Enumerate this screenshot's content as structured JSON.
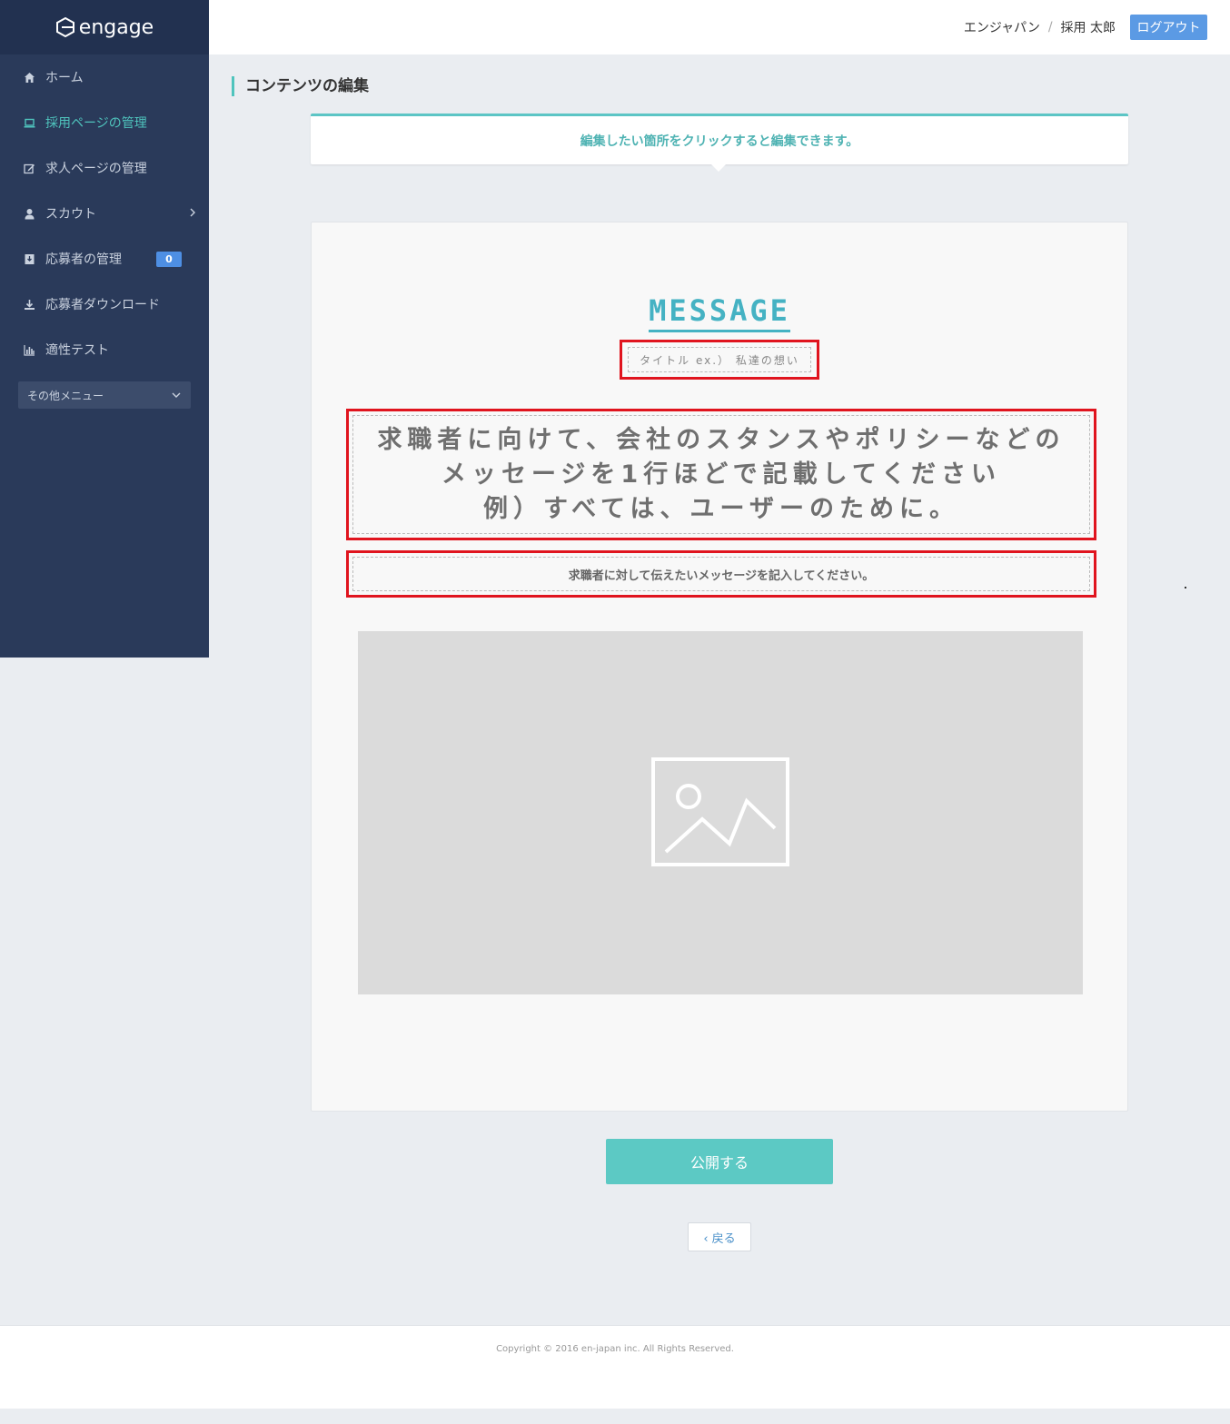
{
  "app": {
    "logo_text": "engage"
  },
  "sidebar": {
    "items": [
      {
        "label": "ホーム",
        "icon": "home-icon"
      },
      {
        "label": "採用ページの管理",
        "icon": "laptop-icon",
        "active": true
      },
      {
        "label": "求人ページの管理",
        "icon": "edit-icon"
      },
      {
        "label": "スカウト",
        "icon": "user-icon"
      },
      {
        "label": "応募者の管理",
        "icon": "inbox-icon",
        "badge": "0"
      },
      {
        "label": "応募者ダウンロード",
        "icon": "download-icon"
      },
      {
        "label": "適性テスト",
        "icon": "bar-chart-icon"
      }
    ],
    "other_menu_label": "その他メニュー"
  },
  "header": {
    "company": "エンジャパン",
    "separator": "/",
    "username": "採用 太郎",
    "logout_label": "ログアウト"
  },
  "page": {
    "title": "コンテンツの編集",
    "notice": "編集したい箇所をクリックすると編集できます。"
  },
  "editor": {
    "heading": "MESSAGE",
    "title_placeholder": "タイトル ex.） 私達の想い",
    "main_message_lines": [
      "求職者に向けて、会社のスタンスやポリシーなどの",
      "メッセージを1行ほどで記載してください",
      "例）すべては、ユーザーのために。"
    ],
    "sub_message": "求職者に対して伝えたいメッセージを記入してください。"
  },
  "actions": {
    "publish_label": "公開する",
    "back_label": "‹ 戻る"
  },
  "footer": {
    "copyright": "Copyright © 2016 en-japan inc. All Rights Reserved."
  },
  "colors": {
    "sidebar_bg": "#2a3a5a",
    "accent": "#4fc4bd",
    "logout": "#5b9ae4",
    "highlight_border": "#e0141e"
  }
}
